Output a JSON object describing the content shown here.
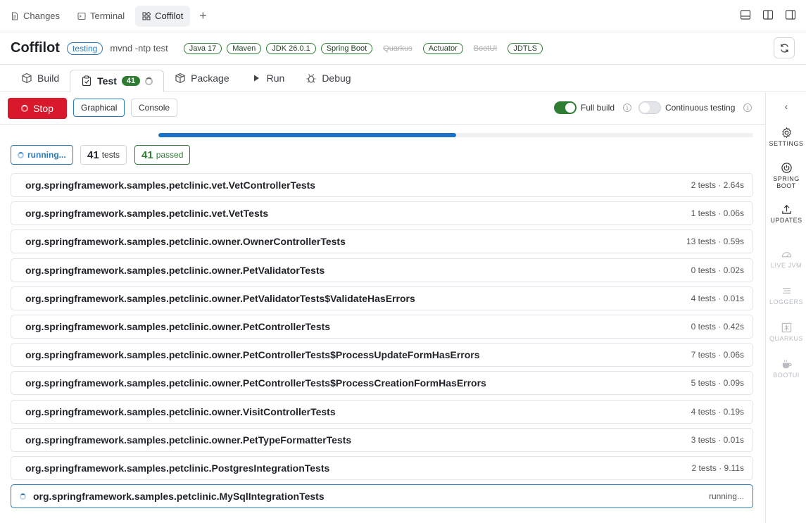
{
  "top_tabs": [
    {
      "label": "Changes",
      "icon": "file-icon"
    },
    {
      "label": "Terminal",
      "icon": "terminal-icon"
    },
    {
      "label": "Coffilot",
      "icon": "grid-icon",
      "active": true
    }
  ],
  "header": {
    "title": "Coffilot",
    "mode_badge": "testing",
    "command": "mvnd -ntp test",
    "chips": [
      {
        "label": "Java 17",
        "enabled": true
      },
      {
        "label": "Maven",
        "enabled": true
      },
      {
        "label": "JDK 26.0.1",
        "enabled": true
      },
      {
        "label": "Spring Boot",
        "enabled": true
      },
      {
        "label": "Quarkus",
        "enabled": false
      },
      {
        "label": "Actuator",
        "enabled": true
      },
      {
        "label": "BootUI",
        "enabled": false
      },
      {
        "label": "JDTLS",
        "enabled": true
      }
    ]
  },
  "tabs": {
    "build": "Build",
    "test": "Test",
    "test_count": "41",
    "package": "Package",
    "run": "Run",
    "debug": "Debug"
  },
  "toolbar": {
    "stop": "Stop",
    "graphical": "Graphical",
    "console": "Console",
    "full_build": "Full build",
    "full_build_on": true,
    "continuous_testing": "Continuous testing",
    "continuous_testing_on": false
  },
  "progress": {
    "fraction": 0.5
  },
  "status": {
    "running": "running...",
    "tests_count": "41",
    "tests_label": "tests",
    "passed_count": "41",
    "passed_label": "passed"
  },
  "test_rows": [
    {
      "name": "org.springframework.samples.petclinic.vet.VetControllerTests",
      "meta": "2 tests · 2.64s"
    },
    {
      "name": "org.springframework.samples.petclinic.vet.VetTests",
      "meta": "1 tests · 0.06s"
    },
    {
      "name": "org.springframework.samples.petclinic.owner.OwnerControllerTests",
      "meta": "13 tests · 0.59s"
    },
    {
      "name": "org.springframework.samples.petclinic.owner.PetValidatorTests",
      "meta": "0 tests · 0.02s"
    },
    {
      "name": "org.springframework.samples.petclinic.owner.PetValidatorTests$ValidateHasErrors",
      "meta": "4 tests · 0.01s"
    },
    {
      "name": "org.springframework.samples.petclinic.owner.PetControllerTests",
      "meta": "0 tests · 0.42s"
    },
    {
      "name": "org.springframework.samples.petclinic.owner.PetControllerTests$ProcessUpdateFormHasErrors",
      "meta": "7 tests · 0.06s"
    },
    {
      "name": "org.springframework.samples.petclinic.owner.PetControllerTests$ProcessCreationFormHasErrors",
      "meta": "5 tests · 0.09s"
    },
    {
      "name": "org.springframework.samples.petclinic.owner.VisitControllerTests",
      "meta": "4 tests · 0.19s"
    },
    {
      "name": "org.springframework.samples.petclinic.owner.PetTypeFormatterTests",
      "meta": "3 tests · 0.01s"
    },
    {
      "name": "org.springframework.samples.petclinic.PostgresIntegrationTests",
      "meta": "2 tests · 9.11s"
    },
    {
      "name": "org.springframework.samples.petclinic.MySqlIntegrationTests",
      "meta": "running...",
      "running": true
    }
  ],
  "sidebar": {
    "items": [
      {
        "label": "SETTINGS",
        "icon": "gear-icon",
        "enabled": true
      },
      {
        "label": "SPRING BOOT",
        "icon": "power-icon",
        "enabled": true
      },
      {
        "label": "UPDATES",
        "icon": "upload-icon",
        "enabled": true
      },
      {
        "label": "LIVE JVM",
        "icon": "gauge-icon",
        "enabled": false
      },
      {
        "label": "LOGGERS",
        "icon": "lines-icon",
        "enabled": false
      },
      {
        "label": "QUARKUS",
        "icon": "quarkus-icon",
        "enabled": false
      },
      {
        "label": "BOOTUI",
        "icon": "cup-icon",
        "enabled": false
      }
    ]
  },
  "colors": {
    "accent_blue": "#2b7bb9",
    "progress_blue": "#1b73c9",
    "success_green": "#2e7d32",
    "stop_red": "#d7192b"
  }
}
